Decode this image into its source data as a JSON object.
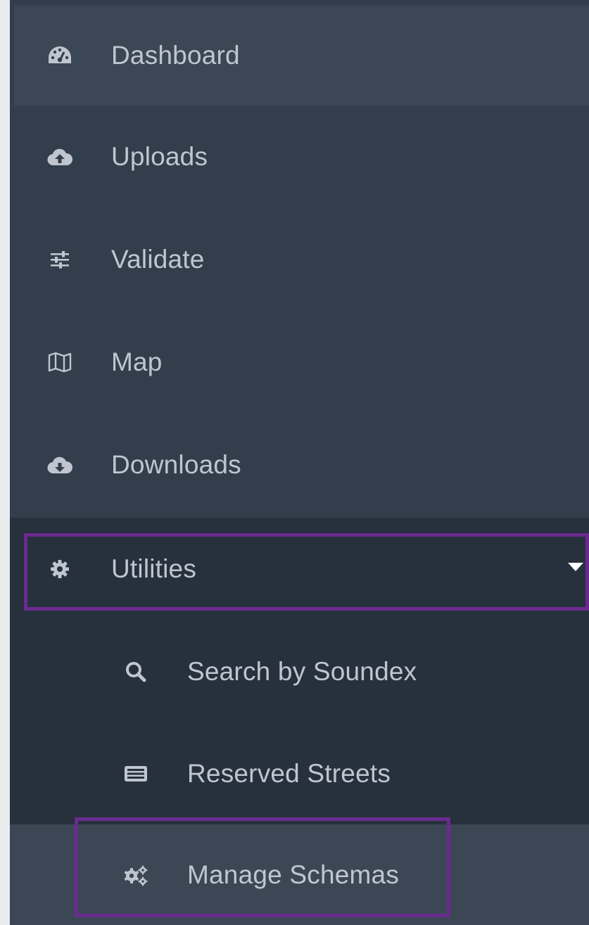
{
  "sidebar": {
    "items": [
      {
        "label": "Dashboard",
        "icon": "dashboard-icon"
      },
      {
        "label": "Uploads",
        "icon": "cloud-upload-icon"
      },
      {
        "label": "Validate",
        "icon": "sliders-icon"
      },
      {
        "label": "Map",
        "icon": "map-icon"
      },
      {
        "label": "Downloads",
        "icon": "cloud-download-icon"
      },
      {
        "label": "Utilities",
        "icon": "gear-icon",
        "expanded": true
      }
    ],
    "utilities_subitems": [
      {
        "label": "Search by Soundex",
        "icon": "search-icon"
      },
      {
        "label": "Reserved Streets",
        "icon": "list-icon"
      },
      {
        "label": "Manage Schemas",
        "icon": "gears-icon"
      }
    ]
  },
  "colors": {
    "sidebar_bg": "#323e4c",
    "active_bg": "#27313d",
    "hover_bg": "#3c4755",
    "text": "#bfc6cf",
    "highlight": "#6a2a8e"
  }
}
